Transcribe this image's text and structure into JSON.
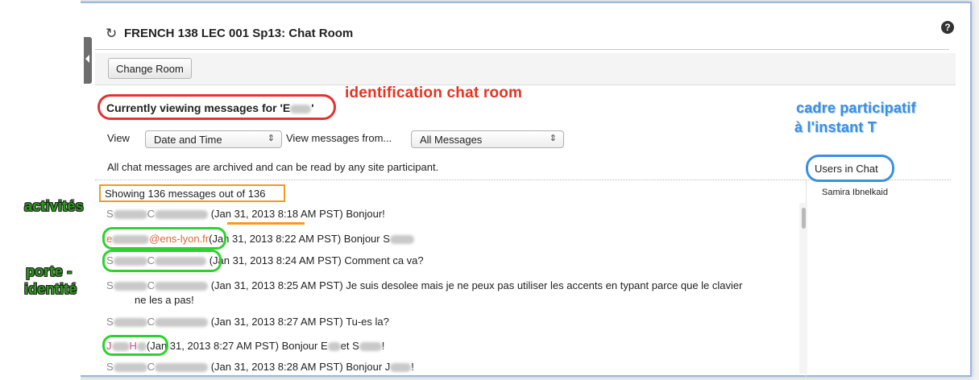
{
  "header": {
    "title": "FRENCH 138 LEC 001 Sp13: Chat Room",
    "refresh_icon": "refresh-icon",
    "help_icon": "help-icon",
    "help_glyph": "?"
  },
  "toolbar": {
    "change_room_label": "Change Room"
  },
  "viewing": {
    "prefix": "Currently viewing messages for 'E",
    "suffix": "'"
  },
  "filters": {
    "view_label": "View",
    "view_selected": "Date and Time",
    "view_from_label": "View messages from...",
    "from_selected": "All Messages"
  },
  "archive_note": "All chat messages are archived and can be read by any site participant.",
  "users_panel": {
    "title": "Users in Chat",
    "users": [
      "Samira Ibnelkaid"
    ]
  },
  "showing": "Showing 136 messages out of 136",
  "messages": [
    {
      "author_start": "S",
      "author_mid": "C",
      "time": "(Jan 31, 2013 8:18 AM PST)",
      "text": "Bonjour!"
    },
    {
      "author_start": "e",
      "author_mid": "@ens-lyon.fr",
      "time": "(Jan 31, 2013 8:22 AM PST)",
      "text": "Bonjour S"
    },
    {
      "author_start": "S",
      "author_mid": "C",
      "time": "(Jan 31, 2013 8:24 AM PST)",
      "text": "Comment ca va?"
    },
    {
      "author_start": "S",
      "author_mid": "C",
      "time": "(Jan 31, 2013 8:25 AM PST)",
      "text": "Je suis desolee mais je ne peux pas utiliser les accents en typant parce que le clavier",
      "text2": "ne les a pas!"
    },
    {
      "author_start": "S",
      "author_mid": "C",
      "time": "(Jan 31, 2013 8:27 AM PST)",
      "text": "Tu-es la?"
    },
    {
      "author_start": "J",
      "author_mid": "H",
      "time": "(Jan 31, 2013 8:27 AM PST)",
      "text": "Bonjour E",
      "text_b": "et S",
      "text_c": "!"
    },
    {
      "author_start": "S",
      "author_mid": "C",
      "time": "(Jan 31, 2013 8:28 AM PST)",
      "text": "Bonjour J",
      "text_c": "!"
    }
  ],
  "annotations": {
    "chat_room_id": "identification chat room",
    "participants_1": "cadre participatif",
    "participants_2": "à l'instant T",
    "activities": "activités",
    "identity_1": "porte -",
    "identity_2": "identité"
  },
  "colors": {
    "red": "#e53232",
    "blue": "#3b8fe0",
    "green": "#2fd12f",
    "orange": "#f39a1f",
    "pink": "#d33a9a"
  }
}
